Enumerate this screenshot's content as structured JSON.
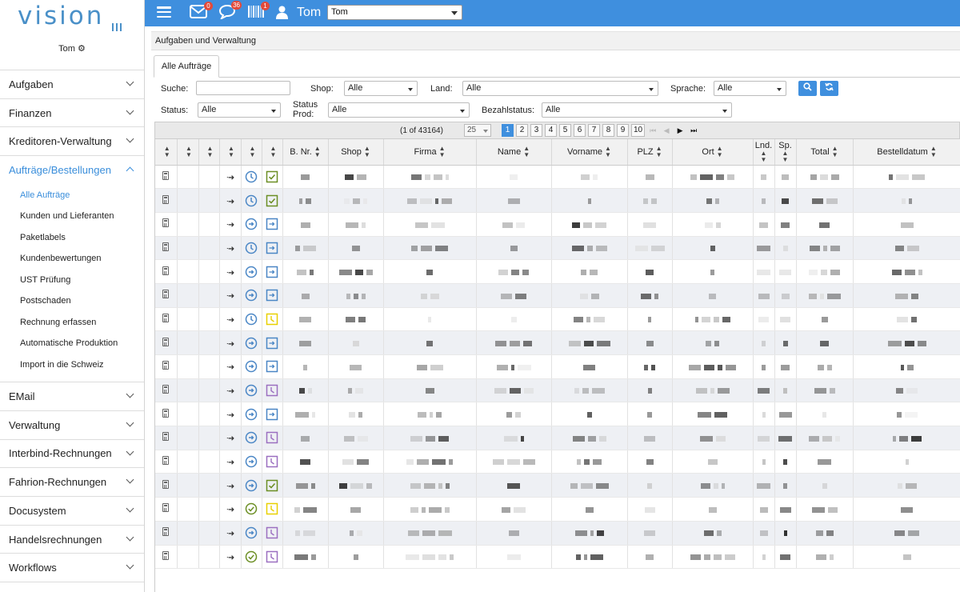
{
  "sidebar": {
    "logo": "vision",
    "user": "Tom",
    "items": [
      {
        "label": "Aufgaben"
      },
      {
        "label": "Finanzen"
      },
      {
        "label": "Kreditoren-Verwaltung"
      },
      {
        "label": "Aufträge/Bestellungen",
        "open": true
      },
      {
        "label": "EMail"
      },
      {
        "label": "Verwaltung"
      },
      {
        "label": "Interbind-Rechnungen"
      },
      {
        "label": "Fahrion-Rechnungen"
      },
      {
        "label": "Docusystem"
      },
      {
        "label": "Handelsrechnungen"
      },
      {
        "label": "Workflows"
      }
    ],
    "subitems": [
      {
        "label": "Alle Aufträge",
        "active": true
      },
      {
        "label": "Kunden und Lieferanten"
      },
      {
        "label": "Paketlabels"
      },
      {
        "label": "Kundenbewertungen"
      },
      {
        "label": "UST Prüfung"
      },
      {
        "label": "Postschaden"
      },
      {
        "label": "Rechnung erfassen"
      },
      {
        "label": "Automatische Produktion"
      },
      {
        "label": "Import in die Schweiz"
      }
    ]
  },
  "topbar": {
    "mail_badge": "0",
    "chat_badge": "36",
    "barcode_badge": "1",
    "user_name": "Tom",
    "user_select": "Tom",
    "accent": "#3f8fde"
  },
  "main": {
    "title": "Aufgaben und Verwaltung",
    "tab": "Alle Aufträge",
    "filters": {
      "search_label": "Suche:",
      "search_value": "",
      "shop_label": "Shop:",
      "shop_value": "Alle",
      "land_label": "Land:",
      "land_value": "Alle",
      "sprache_label": "Sprache:",
      "sprache_value": "Alle",
      "status_label": "Status:",
      "status_value": "Alle",
      "status_prod_label_1": "Status",
      "status_prod_label_2": "Prod:",
      "status_prod_value": "Alle",
      "bezahl_label": "Bezahlstatus:",
      "bezahl_value": "Alle"
    }
  },
  "pager": {
    "count": "(1 of 43164)",
    "per_page": "25",
    "pages": [
      "1",
      "2",
      "3",
      "4",
      "5",
      "6",
      "7",
      "8",
      "9",
      "10"
    ],
    "current": "1"
  },
  "table": {
    "columns": [
      "",
      "",
      "",
      "",
      "",
      "",
      "B. Nr.",
      "Shop",
      "Firma",
      "Name",
      "Vorname",
      "PLZ",
      "Ort",
      "Lnd.",
      "Sp.",
      "Total",
      "Bestelldatum"
    ],
    "rows": [
      {
        "clock": "clock",
        "status": "check-green"
      },
      {
        "clock": "clock",
        "status": "check-green"
      },
      {
        "clock": "circle-arrow",
        "status": "arrow-blue"
      },
      {
        "clock": "clock",
        "status": "arrow-blue"
      },
      {
        "clock": "circle-arrow",
        "status": "arrow-blue"
      },
      {
        "clock": "circle-arrow",
        "status": "arrow-blue"
      },
      {
        "clock": "clock",
        "status": "clock-yellow"
      },
      {
        "clock": "circle-arrow",
        "status": "arrow-blue"
      },
      {
        "clock": "circle-arrow",
        "status": "arrow-blue"
      },
      {
        "clock": "circle-arrow",
        "status": "clock-purple"
      },
      {
        "clock": "circle-arrow",
        "status": "arrow-blue"
      },
      {
        "clock": "circle-arrow",
        "status": "clock-purple"
      },
      {
        "clock": "circle-arrow",
        "status": "clock-purple"
      },
      {
        "clock": "circle-arrow",
        "status": "check-green"
      },
      {
        "clock": "check-circle",
        "status": "clock-yellow"
      },
      {
        "clock": "circle-arrow",
        "status": "clock-purple"
      },
      {
        "clock": "check-circle",
        "status": "clock-purple"
      }
    ]
  }
}
